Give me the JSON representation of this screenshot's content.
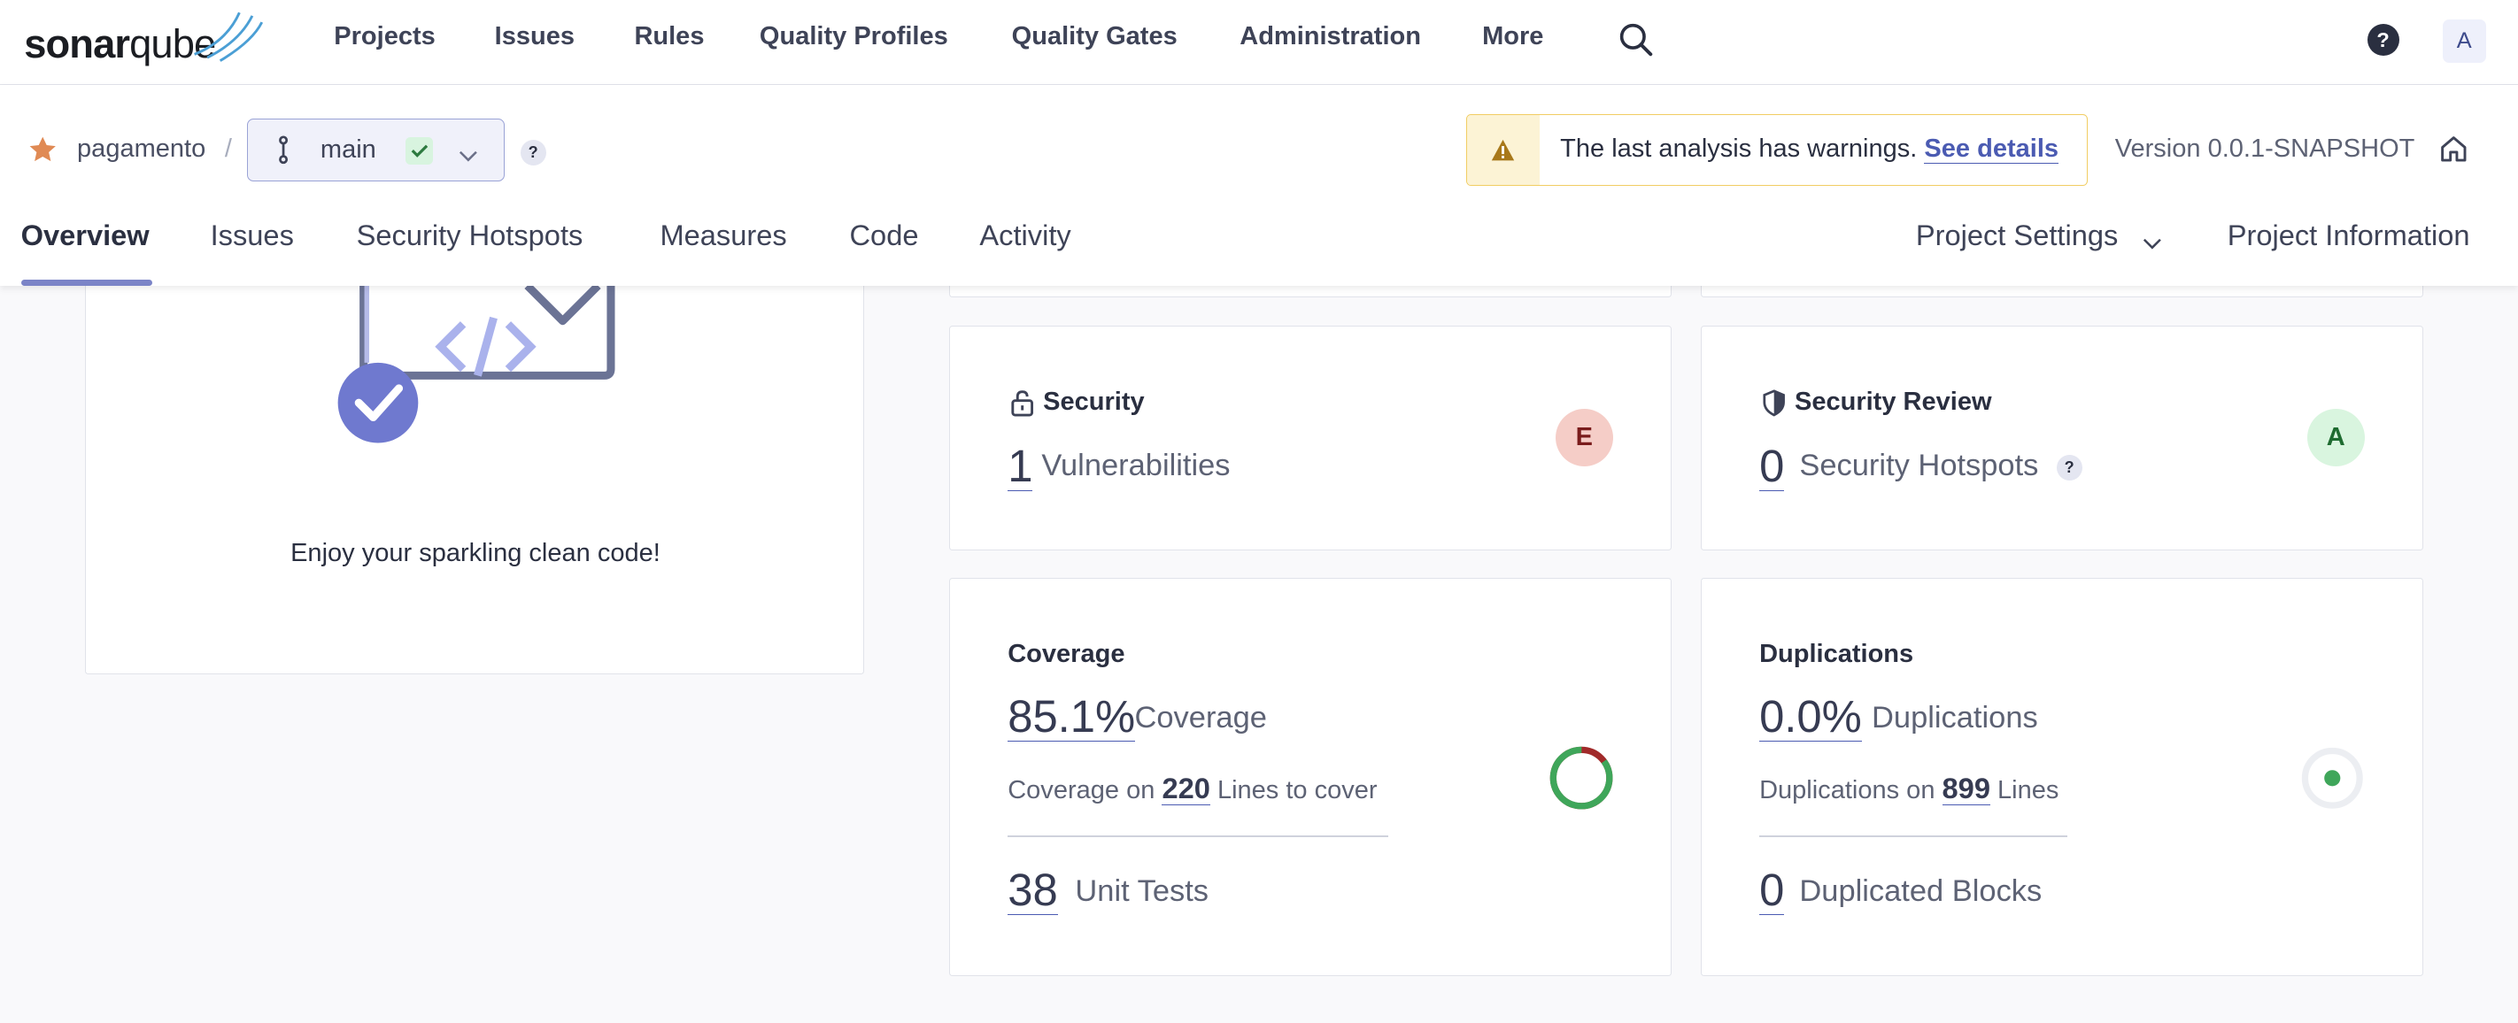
{
  "app": {
    "logo_bold": "sonar",
    "logo_light": "qube"
  },
  "nav": {
    "items": [
      "Projects",
      "Issues",
      "Rules",
      "Quality Profiles",
      "Quality Gates",
      "Administration",
      "More"
    ],
    "help": "?",
    "avatar": "A"
  },
  "project": {
    "name": "pagamento",
    "separator": "/",
    "branch": "main",
    "branch_help": "?",
    "warning_text": "The last analysis has warnings.",
    "warning_link": "See details",
    "version": "Version 0.0.1-SNAPSHOT"
  },
  "tabs": [
    "Overview",
    "Issues",
    "Security Hotspots",
    "Measures",
    "Code",
    "Activity"
  ],
  "right_tabs": {
    "settings": "Project Settings",
    "info": "Project Information"
  },
  "clean": {
    "message": "Enjoy your sparkling clean code!"
  },
  "security": {
    "title": "Security",
    "value": "1",
    "label": "Vulnerabilities",
    "rating": "E",
    "rating_color": "#f5cdc7"
  },
  "review": {
    "title": "Security Review",
    "value": "0",
    "label": "Security Hotspots",
    "help": "?",
    "rating": "A",
    "rating_color": "#d9f5df"
  },
  "coverage": {
    "title": "Coverage",
    "value": "85.1%",
    "label": "Coverage",
    "lines_prefix": "Coverage on",
    "lines_value": "220",
    "lines_suffix": "Lines to cover",
    "tests_value": "38",
    "tests_label": "Unit Tests",
    "percent": 85.1
  },
  "duplications": {
    "title": "Duplications",
    "value": "0.0%",
    "label": "Duplications",
    "lines_prefix": "Duplications on",
    "lines_value": "899",
    "lines_suffix": "Lines",
    "blocks_value": "0",
    "blocks_label": "Duplicated Blocks"
  },
  "colors": {
    "accent": "#4b5bb2",
    "good": "#3fa65a",
    "bad": "#a12a2a",
    "warn": "#f1cd63"
  }
}
